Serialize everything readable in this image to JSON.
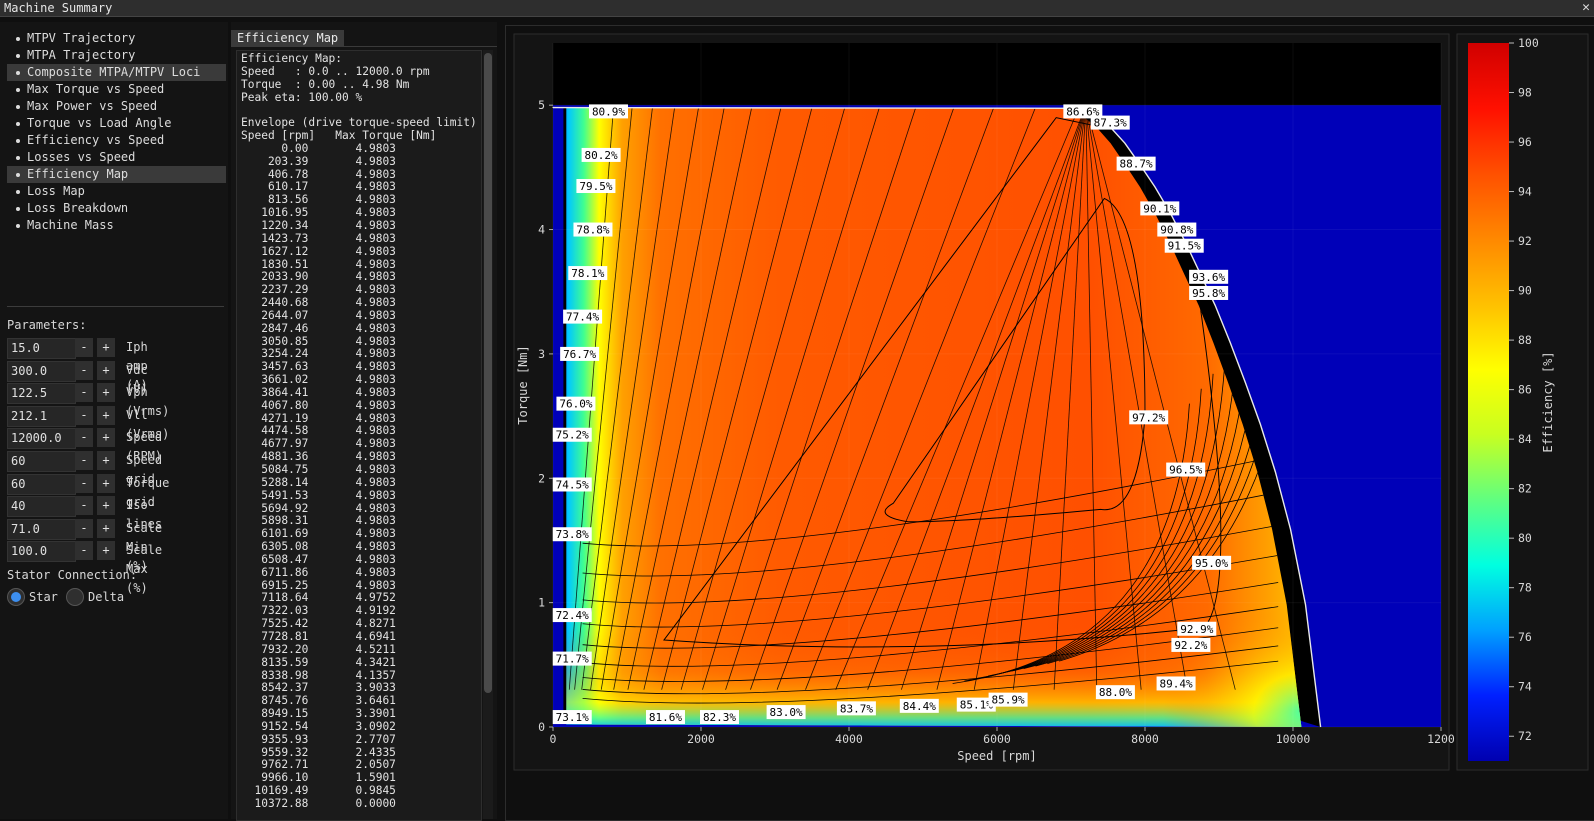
{
  "window": {
    "title": "Machine Summary"
  },
  "nav": {
    "items": [
      {
        "label": "MTPV Trajectory"
      },
      {
        "label": "MTPA Trajectory"
      },
      {
        "label": "Composite MTPA/MTPV Loci"
      },
      {
        "label": "Max Torque vs Speed"
      },
      {
        "label": "Max Power vs Speed"
      },
      {
        "label": "Torque vs Load Angle"
      },
      {
        "label": "Efficiency vs Speed"
      },
      {
        "label": "Losses vs Speed"
      },
      {
        "label": "Efficiency Map"
      },
      {
        "label": "Loss Map"
      },
      {
        "label": "Loss Breakdown"
      },
      {
        "label": "Machine Mass"
      }
    ]
  },
  "params": {
    "title": "Parameters:",
    "rows": [
      {
        "value": "15.0",
        "label": "Iph amp (A)"
      },
      {
        "value": "300.0",
        "label": "Vdc (V)"
      },
      {
        "value": "122.5",
        "label": "Vph (Vrms)"
      },
      {
        "value": "212.1",
        "label": "Vll (Vrms)"
      },
      {
        "value": "12000.0",
        "label": "Speed (RPM)"
      },
      {
        "value": "60",
        "label": "Speed grid"
      },
      {
        "value": "60",
        "label": "Torque grid"
      },
      {
        "value": "40",
        "label": "Iso-lines"
      },
      {
        "value": "71.0",
        "label": "Scale Min (%)"
      },
      {
        "value": "100.0",
        "label": "Scale Max (%)"
      }
    ],
    "minus": "-",
    "plus": "+"
  },
  "connection": {
    "title": "Stator Connection:",
    "star": "Star",
    "delta": "Delta",
    "selected": "Star"
  },
  "report": {
    "tab": "Efficiency Map",
    "header": [
      "Efficiency Map:",
      "Speed   : 0.0 .. 12000.0 rpm",
      "Torque  : 0.00 .. 4.98 Nm",
      "Peak eta: 100.00 %",
      "",
      "Envelope (drive torque-speed limit)",
      "Speed [rpm]   Max Torque [Nm]"
    ],
    "rows": [
      [
        "0.00",
        "4.9803"
      ],
      [
        "203.39",
        "4.9803"
      ],
      [
        "406.78",
        "4.9803"
      ],
      [
        "610.17",
        "4.9803"
      ],
      [
        "813.56",
        "4.9803"
      ],
      [
        "1016.95",
        "4.9803"
      ],
      [
        "1220.34",
        "4.9803"
      ],
      [
        "1423.73",
        "4.9803"
      ],
      [
        "1627.12",
        "4.9803"
      ],
      [
        "1830.51",
        "4.9803"
      ],
      [
        "2033.90",
        "4.9803"
      ],
      [
        "2237.29",
        "4.9803"
      ],
      [
        "2440.68",
        "4.9803"
      ],
      [
        "2644.07",
        "4.9803"
      ],
      [
        "2847.46",
        "4.9803"
      ],
      [
        "3050.85",
        "4.9803"
      ],
      [
        "3254.24",
        "4.9803"
      ],
      [
        "3457.63",
        "4.9803"
      ],
      [
        "3661.02",
        "4.9803"
      ],
      [
        "3864.41",
        "4.9803"
      ],
      [
        "4067.80",
        "4.9803"
      ],
      [
        "4271.19",
        "4.9803"
      ],
      [
        "4474.58",
        "4.9803"
      ],
      [
        "4677.97",
        "4.9803"
      ],
      [
        "4881.36",
        "4.9803"
      ],
      [
        "5084.75",
        "4.9803"
      ],
      [
        "5288.14",
        "4.9803"
      ],
      [
        "5491.53",
        "4.9803"
      ],
      [
        "5694.92",
        "4.9803"
      ],
      [
        "5898.31",
        "4.9803"
      ],
      [
        "6101.69",
        "4.9803"
      ],
      [
        "6305.08",
        "4.9803"
      ],
      [
        "6508.47",
        "4.9803"
      ],
      [
        "6711.86",
        "4.9803"
      ],
      [
        "6915.25",
        "4.9803"
      ],
      [
        "7118.64",
        "4.9752"
      ],
      [
        "7322.03",
        "4.9192"
      ],
      [
        "7525.42",
        "4.8271"
      ],
      [
        "7728.81",
        "4.6941"
      ],
      [
        "7932.20",
        "4.5211"
      ],
      [
        "8135.59",
        "4.3421"
      ],
      [
        "8338.98",
        "4.1357"
      ],
      [
        "8542.37",
        "3.9033"
      ],
      [
        "8745.76",
        "3.6461"
      ],
      [
        "8949.15",
        "3.3901"
      ],
      [
        "9152.54",
        "3.0902"
      ],
      [
        "9355.93",
        "2.7707"
      ],
      [
        "9559.32",
        "2.4335"
      ],
      [
        "9762.71",
        "2.0507"
      ],
      [
        "9966.10",
        "1.5901"
      ],
      [
        "10169.49",
        "0.9845"
      ],
      [
        "10372.88",
        "0.0000"
      ]
    ]
  },
  "chart_data": {
    "type": "heatmap",
    "xlabel": "Speed [rpm]",
    "ylabel": "Torque [Nm]",
    "xlim": [
      0,
      12000
    ],
    "ylim": [
      0,
      5.5
    ],
    "xticks": [
      "0",
      "2000",
      "4000",
      "6000",
      "8000",
      "10000",
      "1200"
    ],
    "yticks": [
      "0",
      "1",
      "2",
      "3",
      "4",
      "5"
    ],
    "colorbar": {
      "label": "Efficiency [%]",
      "min": 71,
      "max": 100,
      "ticks": [
        "72",
        "74",
        "76",
        "78",
        "80",
        "82",
        "84",
        "86",
        "88",
        "90",
        "92",
        "94",
        "96",
        "98",
        "100"
      ]
    },
    "envelope": {
      "speed": [
        0,
        7118.64,
        7322.03,
        7525.42,
        7728.81,
        7932.2,
        8135.59,
        8338.98,
        8542.37,
        8745.76,
        8949.15,
        9152.54,
        9355.93,
        9559.32,
        9762.71,
        9966.1,
        10169.49,
        10372.88
      ],
      "torque": [
        4.9803,
        4.9752,
        4.9192,
        4.8271,
        4.6941,
        4.5211,
        4.3421,
        4.1357,
        3.9033,
        3.6461,
        3.3901,
        3.0902,
        2.7707,
        2.4335,
        2.0507,
        1.5901,
        0.9845,
        0.0
      ]
    },
    "contour_labels": [
      {
        "text": "80.9%",
        "x": 750,
        "y": 4.95
      },
      {
        "text": "80.2%",
        "x": 650,
        "y": 4.6
      },
      {
        "text": "79.5%",
        "x": 580,
        "y": 4.35
      },
      {
        "text": "78.8%",
        "x": 540,
        "y": 4.0
      },
      {
        "text": "78.1%",
        "x": 470,
        "y": 3.65
      },
      {
        "text": "77.4%",
        "x": 400,
        "y": 3.3
      },
      {
        "text": "76.7%",
        "x": 360,
        "y": 3.0
      },
      {
        "text": "76.0%",
        "x": 310,
        "y": 2.6
      },
      {
        "text": "75.2%",
        "x": 260,
        "y": 2.35
      },
      {
        "text": "74.5%",
        "x": 260,
        "y": 1.95
      },
      {
        "text": "73.8%",
        "x": 260,
        "y": 1.55
      },
      {
        "text": "72.4%",
        "x": 260,
        "y": 0.9
      },
      {
        "text": "71.7%",
        "x": 260,
        "y": 0.55
      },
      {
        "text": "73.1%",
        "x": 260,
        "y": 0.08
      },
      {
        "text": "81.6%",
        "x": 1520,
        "y": 0.08
      },
      {
        "text": "82.3%",
        "x": 2250,
        "y": 0.08
      },
      {
        "text": "83.0%",
        "x": 3150,
        "y": 0.12
      },
      {
        "text": "83.7%",
        "x": 4100,
        "y": 0.15
      },
      {
        "text": "84.4%",
        "x": 4950,
        "y": 0.17
      },
      {
        "text": "85.1%",
        "x": 5720,
        "y": 0.18
      },
      {
        "text": "85.9%",
        "x": 6150,
        "y": 0.22
      },
      {
        "text": "88.0%",
        "x": 7600,
        "y": 0.28
      },
      {
        "text": "89.4%",
        "x": 8420,
        "y": 0.35
      },
      {
        "text": "92.2%",
        "x": 8620,
        "y": 0.66
      },
      {
        "text": "92.9%",
        "x": 8700,
        "y": 0.79
      },
      {
        "text": "95.0%",
        "x": 8900,
        "y": 1.32
      },
      {
        "text": "96.5%",
        "x": 8550,
        "y": 2.07
      },
      {
        "text": "97.2%",
        "x": 8050,
        "y": 2.49
      },
      {
        "text": "86.6%",
        "x": 7160,
        "y": 4.95
      },
      {
        "text": "87.3%",
        "x": 7530,
        "y": 4.86
      },
      {
        "text": "88.7%",
        "x": 7880,
        "y": 4.53
      },
      {
        "text": "90.1%",
        "x": 8200,
        "y": 4.17
      },
      {
        "text": "90.8%",
        "x": 8430,
        "y": 4.0
      },
      {
        "text": "91.5%",
        "x": 8530,
        "y": 3.87
      },
      {
        "text": "93.6%",
        "x": 8860,
        "y": 3.62
      },
      {
        "text": "95.8%",
        "x": 8860,
        "y": 3.49
      }
    ],
    "grid": true
  }
}
